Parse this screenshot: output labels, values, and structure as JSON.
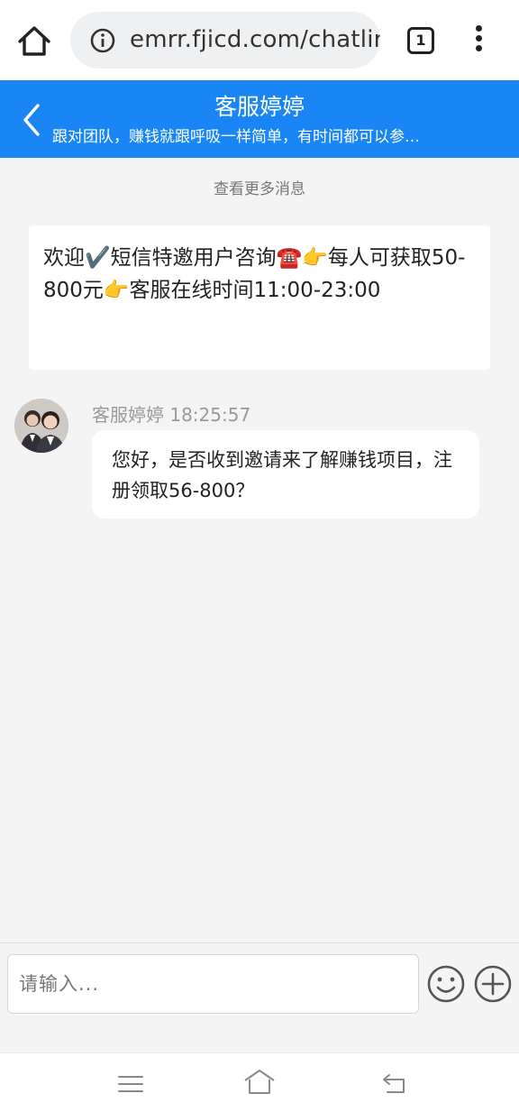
{
  "browser": {
    "url": "emrr.fjicd.com/chatlir",
    "tab_count": "1",
    "icons": {
      "home": "home-icon",
      "info": "info-icon",
      "menu": "kebab-menu-icon"
    }
  },
  "header": {
    "title": "客服婷婷",
    "subtitle": "跟对团队，赚钱就跟呼吸一样简单，有时间都可以参…",
    "color": "#1a86f5"
  },
  "chat": {
    "load_more": "查看更多消息",
    "welcome": "欢迎✔️短信特邀用户咨询☎️👉每人可获取50-800元👉客服在线时间11:00-23:00",
    "message": {
      "sender": "客服婷婷",
      "time": "18:25:57",
      "text": "您好，是否收到邀请来了解赚钱项目，注册领取56-800？"
    }
  },
  "composer": {
    "placeholder": "请输入...",
    "icons": {
      "emoji": "smiley-icon",
      "add": "plus-circle-icon"
    }
  },
  "system_nav": {
    "icons": [
      "menu-lines-icon",
      "home-outline-icon",
      "back-return-icon"
    ]
  }
}
